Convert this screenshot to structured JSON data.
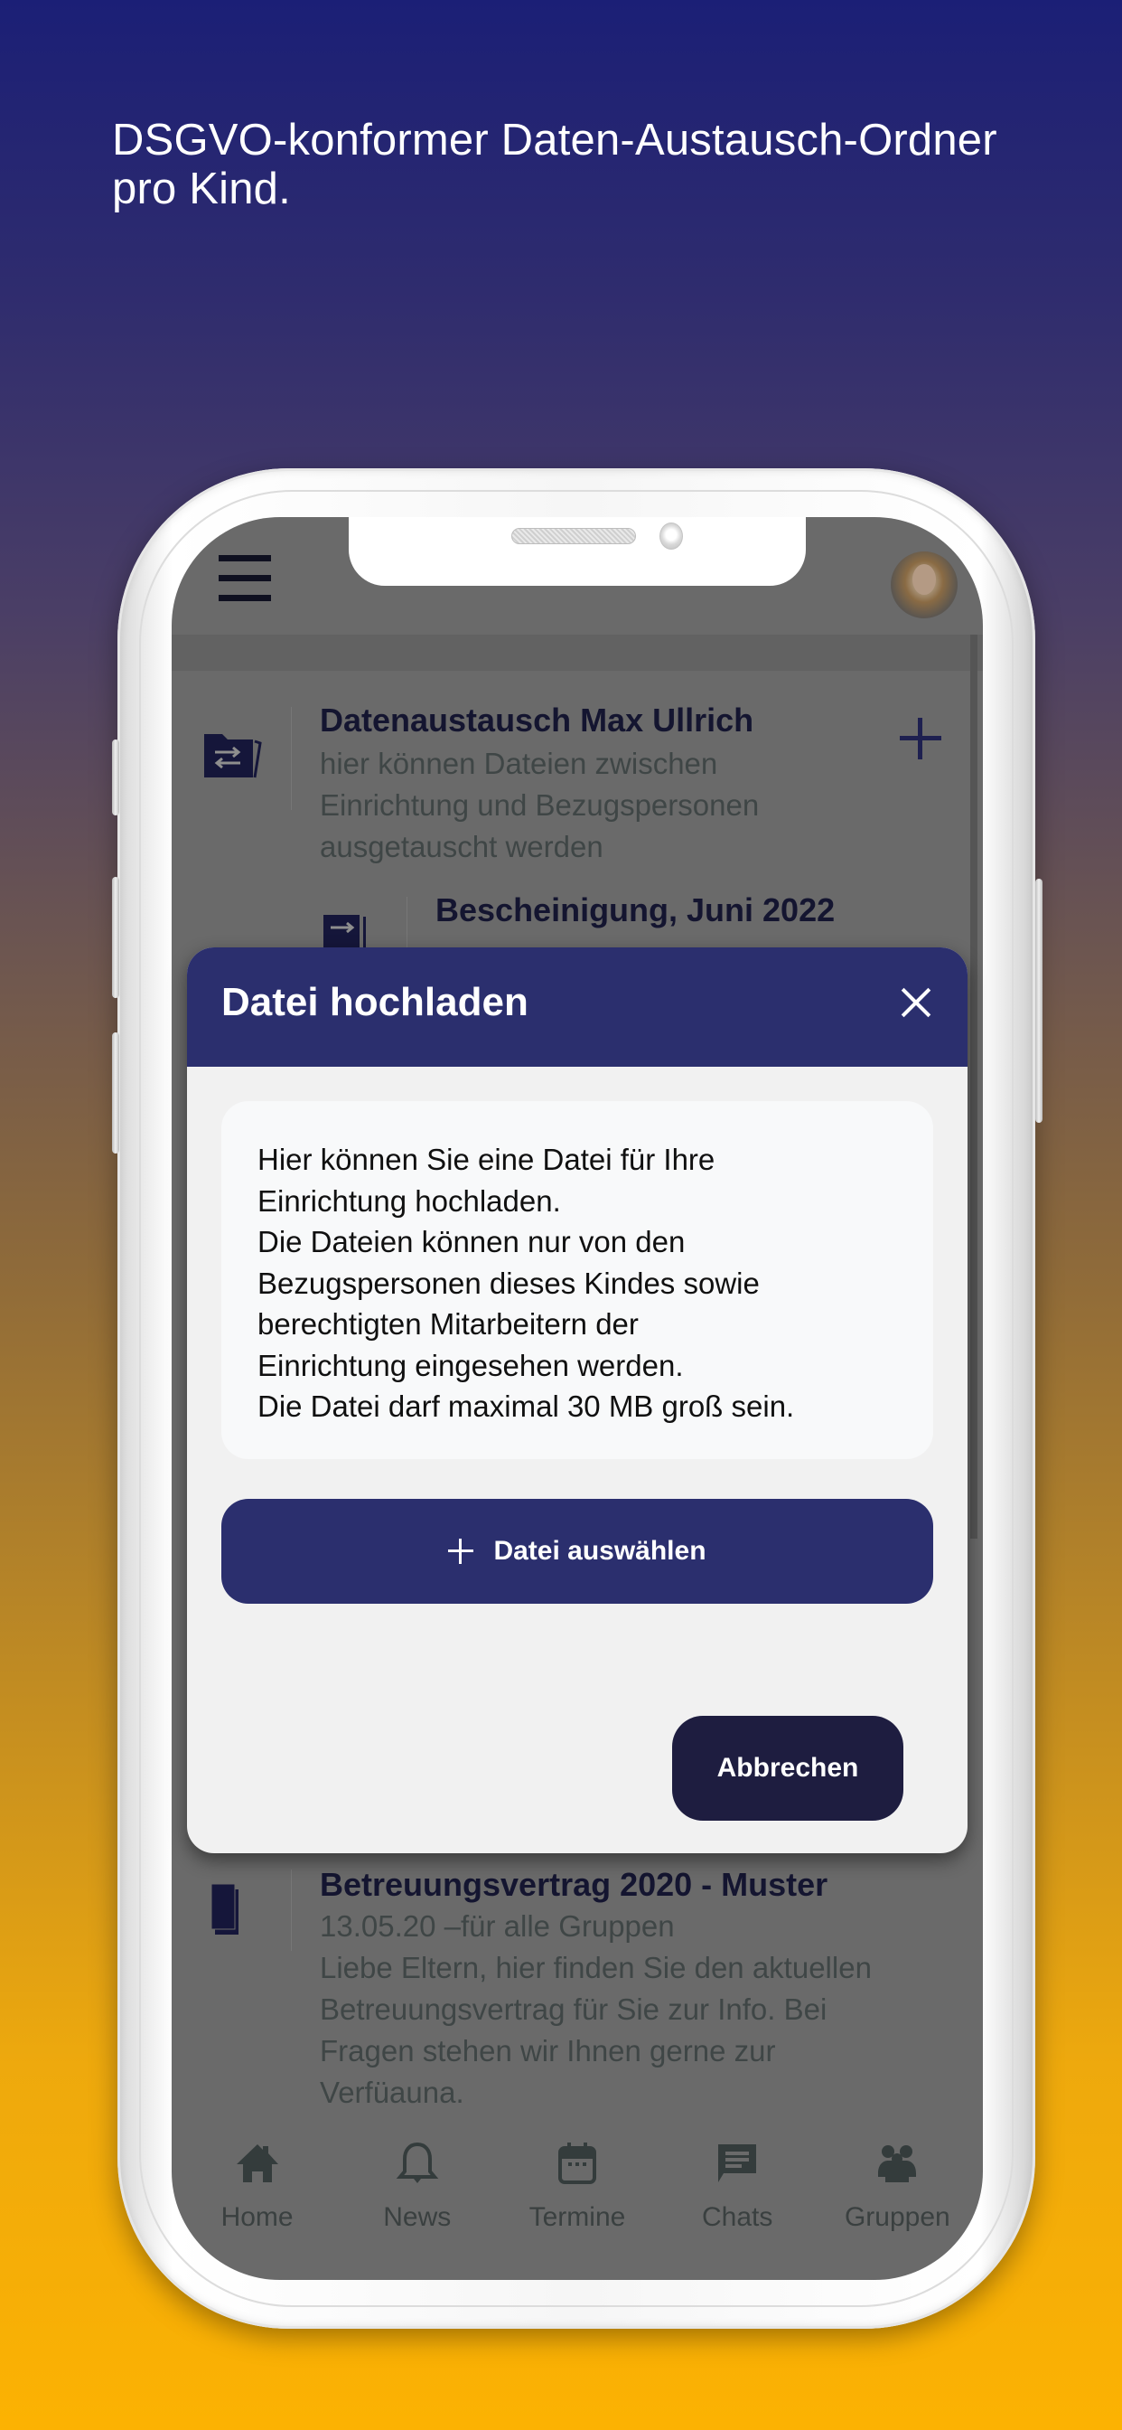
{
  "headline": "DSGVO-konformer Daten-Austausch-Ordner\npro Kind.",
  "colors": {
    "background_top": "#1b1f76",
    "background_bottom": "#fcb202",
    "modal_header": "#2b2f6e",
    "primary_button": "#2b2f6e",
    "cancel_button": "#1e1d40",
    "overlay_gray": "#6a6a6a"
  },
  "app": {
    "header": {
      "menu_icon": "hamburger-icon",
      "avatar": "user-avatar"
    },
    "folder": {
      "icon": "folder-exchange-icon",
      "title": "Datenaustausch Max Ullrich",
      "description_lines": [
        "hier können Dateien zwischen",
        "Einrichtung und Bezugspersonen",
        "ausgetauscht werden"
      ],
      "add_icon": "plus-icon"
    },
    "files": [
      {
        "icon": "file-exchange-icon",
        "title": "Bescheinigung, Juni 2022"
      },
      {
        "icon": "document-icon",
        "title": "Betreuungsvertrag 2020 - Muster",
        "meta": "13.05.20 –für alle Gruppen",
        "body_lines": [
          "Liebe Eltern, hier finden Sie den aktuellen",
          "Betreuungsvertrag für Sie zur Info. Bei",
          "Fragen stehen wir Ihnen gerne zur",
          "Verfüauna."
        ]
      }
    ],
    "bottom_nav": [
      {
        "label": "Home",
        "icon": "home-icon"
      },
      {
        "label": "News",
        "icon": "bell-icon"
      },
      {
        "label": "Termine",
        "icon": "calendar-icon"
      },
      {
        "label": "Chats",
        "icon": "chat-icon"
      },
      {
        "label": "Gruppen",
        "icon": "group-icon"
      }
    ]
  },
  "modal": {
    "title": "Datei hochladen",
    "close_icon": "close-icon",
    "info_lines": [
      "Hier können Sie eine Datei für Ihre",
      "Einrichtung hochladen.",
      "Die Dateien können nur von den",
      "Bezugspersonen dieses Kindes sowie",
      "berechtigten Mitarbeitern der",
      "Einrichtung eingesehen werden.",
      "Die Datei darf maximal 30 MB groß sein."
    ],
    "select_button_label": "Datei auswählen",
    "cancel_button_label": "Abbrechen"
  }
}
